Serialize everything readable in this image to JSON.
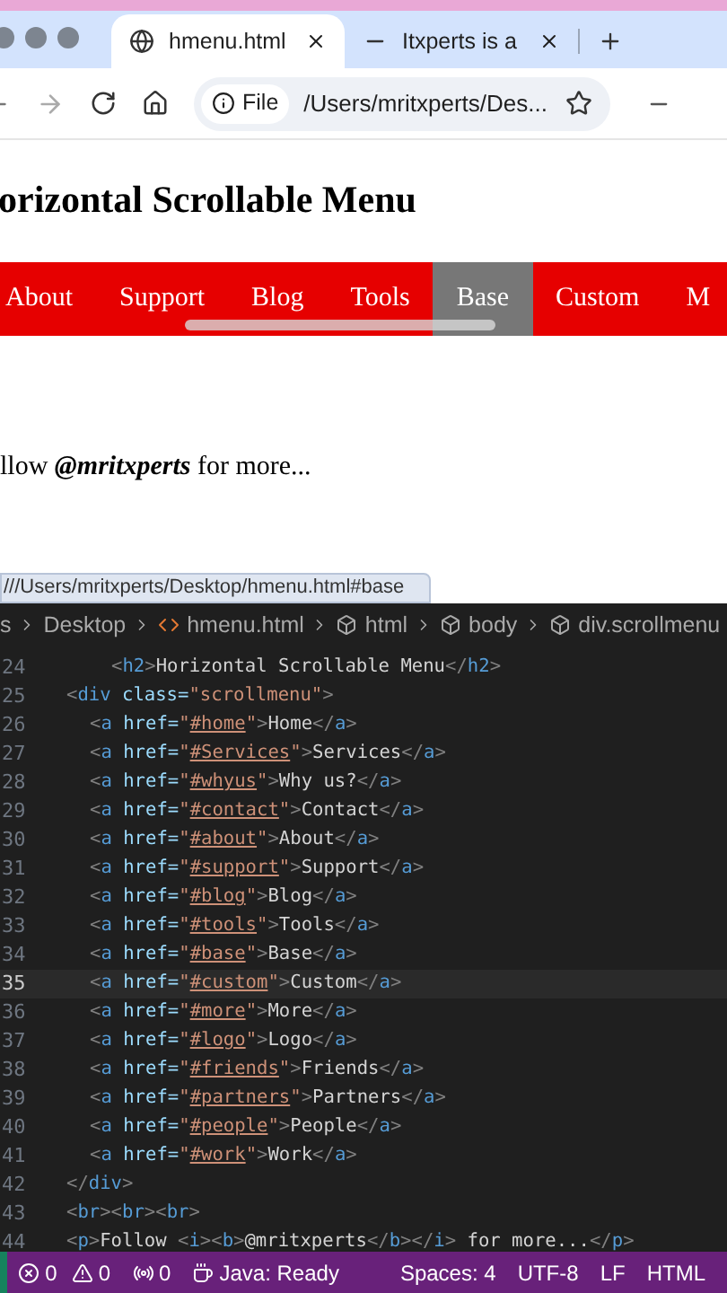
{
  "browser": {
    "tabs": [
      {
        "title": "hmenu.html",
        "selected": true
      },
      {
        "title": "Itxperts is a",
        "selected": false
      }
    ],
    "address": {
      "chip": "File",
      "url": "/Users/mritxperts/Des..."
    }
  },
  "page": {
    "heading": "orizontal Scrollable Menu",
    "menu": [
      {
        "label": "About",
        "selected": false
      },
      {
        "label": "Support",
        "selected": false
      },
      {
        "label": "Blog",
        "selected": false
      },
      {
        "label": "Tools",
        "selected": false
      },
      {
        "label": "Base",
        "selected": true
      },
      {
        "label": "Custom",
        "selected": false
      },
      {
        "label": "M",
        "selected": false
      }
    ],
    "follow": {
      "before": "llow ",
      "handle": "@mritxperts",
      "after": " for more..."
    },
    "link_preview": "///Users/mritxperts/Desktop/hmenu.html#base"
  },
  "editor": {
    "breadcrumbs": [
      {
        "label": "s",
        "kind": "folder"
      },
      {
        "label": "Desktop",
        "kind": "folder"
      },
      {
        "label": "hmenu.html",
        "kind": "file"
      },
      {
        "label": "html",
        "kind": "symbol"
      },
      {
        "label": "body",
        "kind": "symbol"
      },
      {
        "label": "div.scrollmenu",
        "kind": "symbol"
      }
    ],
    "lines": [
      {
        "number": "24",
        "current": false,
        "kind": "deep",
        "segments": [
          {
            "kind": "punct",
            "text": "<"
          },
          {
            "kind": "tag",
            "text": "h2"
          },
          {
            "kind": "punct",
            "text": ">"
          },
          {
            "kind": "text",
            "text": "Horizontal Scrollable Menu"
          },
          {
            "kind": "punct",
            "text": "</"
          },
          {
            "kind": "tag",
            "text": "h2"
          },
          {
            "kind": "punct",
            "text": ">"
          }
        ]
      },
      {
        "number": "25",
        "current": false,
        "segments": [
          {
            "kind": "punct",
            "text": "<"
          },
          {
            "kind": "tag",
            "text": "div"
          },
          {
            "kind": "attr",
            "text": " class="
          },
          {
            "kind": "str",
            "text": "\"scrollmenu\""
          },
          {
            "kind": "punct",
            "text": ">"
          }
        ]
      },
      {
        "number": "26",
        "current": false,
        "kind": "nested",
        "segments": [
          {
            "kind": "punct",
            "text": "<"
          },
          {
            "kind": "tag",
            "text": "a"
          },
          {
            "kind": "attr",
            "text": " href="
          },
          {
            "kind": "str",
            "text": "\""
          },
          {
            "kind": "link",
            "text": "#home"
          },
          {
            "kind": "str",
            "text": "\""
          },
          {
            "kind": "punct",
            "text": ">"
          },
          {
            "kind": "text",
            "text": "Home"
          },
          {
            "kind": "punct",
            "text": "</"
          },
          {
            "kind": "tag",
            "text": "a"
          },
          {
            "kind": "punct",
            "text": ">"
          }
        ]
      },
      {
        "number": "27",
        "current": false,
        "kind": "nested",
        "segments": [
          {
            "kind": "punct",
            "text": "<"
          },
          {
            "kind": "tag",
            "text": "a"
          },
          {
            "kind": "attr",
            "text": " href="
          },
          {
            "kind": "str",
            "text": "\""
          },
          {
            "kind": "link",
            "text": "#Services"
          },
          {
            "kind": "str",
            "text": "\""
          },
          {
            "kind": "punct",
            "text": ">"
          },
          {
            "kind": "text",
            "text": "Services"
          },
          {
            "kind": "punct",
            "text": "</"
          },
          {
            "kind": "tag",
            "text": "a"
          },
          {
            "kind": "punct",
            "text": ">"
          }
        ]
      },
      {
        "number": "28",
        "current": false,
        "kind": "nested",
        "segments": [
          {
            "kind": "punct",
            "text": "<"
          },
          {
            "kind": "tag",
            "text": "a"
          },
          {
            "kind": "attr",
            "text": " href="
          },
          {
            "kind": "str",
            "text": "\""
          },
          {
            "kind": "link",
            "text": "#whyus"
          },
          {
            "kind": "str",
            "text": "\""
          },
          {
            "kind": "punct",
            "text": ">"
          },
          {
            "kind": "text",
            "text": "Why us?"
          },
          {
            "kind": "punct",
            "text": "</"
          },
          {
            "kind": "tag",
            "text": "a"
          },
          {
            "kind": "punct",
            "text": ">"
          }
        ]
      },
      {
        "number": "29",
        "current": false,
        "kind": "nested",
        "segments": [
          {
            "kind": "punct",
            "text": "<"
          },
          {
            "kind": "tag",
            "text": "a"
          },
          {
            "kind": "attr",
            "text": " href="
          },
          {
            "kind": "str",
            "text": "\""
          },
          {
            "kind": "link",
            "text": "#contact"
          },
          {
            "kind": "str",
            "text": "\""
          },
          {
            "kind": "punct",
            "text": ">"
          },
          {
            "kind": "text",
            "text": "Contact"
          },
          {
            "kind": "punct",
            "text": "</"
          },
          {
            "kind": "tag",
            "text": "a"
          },
          {
            "kind": "punct",
            "text": ">"
          }
        ]
      },
      {
        "number": "30",
        "current": false,
        "kind": "nested",
        "segments": [
          {
            "kind": "punct",
            "text": "<"
          },
          {
            "kind": "tag",
            "text": "a"
          },
          {
            "kind": "attr",
            "text": " href="
          },
          {
            "kind": "str",
            "text": "\""
          },
          {
            "kind": "link",
            "text": "#about"
          },
          {
            "kind": "str",
            "text": "\""
          },
          {
            "kind": "punct",
            "text": ">"
          },
          {
            "kind": "text",
            "text": "About"
          },
          {
            "kind": "punct",
            "text": "</"
          },
          {
            "kind": "tag",
            "text": "a"
          },
          {
            "kind": "punct",
            "text": ">"
          }
        ]
      },
      {
        "number": "31",
        "current": false,
        "kind": "nested",
        "segments": [
          {
            "kind": "punct",
            "text": "<"
          },
          {
            "kind": "tag",
            "text": "a"
          },
          {
            "kind": "attr",
            "text": " href="
          },
          {
            "kind": "str",
            "text": "\""
          },
          {
            "kind": "link",
            "text": "#support"
          },
          {
            "kind": "str",
            "text": "\""
          },
          {
            "kind": "punct",
            "text": ">"
          },
          {
            "kind": "text",
            "text": "Support"
          },
          {
            "kind": "punct",
            "text": "</"
          },
          {
            "kind": "tag",
            "text": "a"
          },
          {
            "kind": "punct",
            "text": ">"
          }
        ]
      },
      {
        "number": "32",
        "current": false,
        "kind": "nested",
        "segments": [
          {
            "kind": "punct",
            "text": "<"
          },
          {
            "kind": "tag",
            "text": "a"
          },
          {
            "kind": "attr",
            "text": " href="
          },
          {
            "kind": "str",
            "text": "\""
          },
          {
            "kind": "link",
            "text": "#blog"
          },
          {
            "kind": "str",
            "text": "\""
          },
          {
            "kind": "punct",
            "text": ">"
          },
          {
            "kind": "text",
            "text": "Blog"
          },
          {
            "kind": "punct",
            "text": "</"
          },
          {
            "kind": "tag",
            "text": "a"
          },
          {
            "kind": "punct",
            "text": ">"
          }
        ]
      },
      {
        "number": "33",
        "current": false,
        "kind": "nested",
        "segments": [
          {
            "kind": "punct",
            "text": "<"
          },
          {
            "kind": "tag",
            "text": "a"
          },
          {
            "kind": "attr",
            "text": " href="
          },
          {
            "kind": "str",
            "text": "\""
          },
          {
            "kind": "link",
            "text": "#tools"
          },
          {
            "kind": "str",
            "text": "\""
          },
          {
            "kind": "punct",
            "text": ">"
          },
          {
            "kind": "text",
            "text": "Tools"
          },
          {
            "kind": "punct",
            "text": "</"
          },
          {
            "kind": "tag",
            "text": "a"
          },
          {
            "kind": "punct",
            "text": ">"
          }
        ]
      },
      {
        "number": "34",
        "current": false,
        "kind": "nested",
        "segments": [
          {
            "kind": "punct",
            "text": "<"
          },
          {
            "kind": "tag",
            "text": "a"
          },
          {
            "kind": "attr",
            "text": " href="
          },
          {
            "kind": "str",
            "text": "\""
          },
          {
            "kind": "link",
            "text": "#base"
          },
          {
            "kind": "str",
            "text": "\""
          },
          {
            "kind": "punct",
            "text": ">"
          },
          {
            "kind": "text",
            "text": "Base"
          },
          {
            "kind": "punct",
            "text": "</"
          },
          {
            "kind": "tag",
            "text": "a"
          },
          {
            "kind": "punct",
            "text": ">"
          }
        ]
      },
      {
        "number": "35",
        "current": true,
        "kind": "nested",
        "segments": [
          {
            "kind": "punct",
            "text": "<"
          },
          {
            "kind": "tag",
            "text": "a"
          },
          {
            "kind": "attr",
            "text": " href="
          },
          {
            "kind": "str",
            "text": "\""
          },
          {
            "kind": "link",
            "text": "#custom"
          },
          {
            "kind": "str",
            "text": "\""
          },
          {
            "kind": "punct",
            "text": ">"
          },
          {
            "kind": "text",
            "text": "Custom"
          },
          {
            "kind": "punct",
            "text": "</"
          },
          {
            "kind": "tag",
            "text": "a"
          },
          {
            "kind": "punct",
            "text": ">"
          }
        ]
      },
      {
        "number": "36",
        "current": false,
        "kind": "nested",
        "segments": [
          {
            "kind": "punct",
            "text": "<"
          },
          {
            "kind": "tag",
            "text": "a"
          },
          {
            "kind": "attr",
            "text": " href="
          },
          {
            "kind": "str",
            "text": "\""
          },
          {
            "kind": "link",
            "text": "#more"
          },
          {
            "kind": "str",
            "text": "\""
          },
          {
            "kind": "punct",
            "text": ">"
          },
          {
            "kind": "text",
            "text": "More"
          },
          {
            "kind": "punct",
            "text": "</"
          },
          {
            "kind": "tag",
            "text": "a"
          },
          {
            "kind": "punct",
            "text": ">"
          }
        ]
      },
      {
        "number": "37",
        "current": false,
        "kind": "nested",
        "segments": [
          {
            "kind": "punct",
            "text": "<"
          },
          {
            "kind": "tag",
            "text": "a"
          },
          {
            "kind": "attr",
            "text": " href="
          },
          {
            "kind": "str",
            "text": "\""
          },
          {
            "kind": "link",
            "text": "#logo"
          },
          {
            "kind": "str",
            "text": "\""
          },
          {
            "kind": "punct",
            "text": ">"
          },
          {
            "kind": "text",
            "text": "Logo"
          },
          {
            "kind": "punct",
            "text": "</"
          },
          {
            "kind": "tag",
            "text": "a"
          },
          {
            "kind": "punct",
            "text": ">"
          }
        ]
      },
      {
        "number": "38",
        "current": false,
        "kind": "nested",
        "segments": [
          {
            "kind": "punct",
            "text": "<"
          },
          {
            "kind": "tag",
            "text": "a"
          },
          {
            "kind": "attr",
            "text": " href="
          },
          {
            "kind": "str",
            "text": "\""
          },
          {
            "kind": "link",
            "text": "#friends"
          },
          {
            "kind": "str",
            "text": "\""
          },
          {
            "kind": "punct",
            "text": ">"
          },
          {
            "kind": "text",
            "text": "Friends"
          },
          {
            "kind": "punct",
            "text": "</"
          },
          {
            "kind": "tag",
            "text": "a"
          },
          {
            "kind": "punct",
            "text": ">"
          }
        ]
      },
      {
        "number": "39",
        "current": false,
        "kind": "nested",
        "segments": [
          {
            "kind": "punct",
            "text": "<"
          },
          {
            "kind": "tag",
            "text": "a"
          },
          {
            "kind": "attr",
            "text": " href="
          },
          {
            "kind": "str",
            "text": "\""
          },
          {
            "kind": "link",
            "text": "#partners"
          },
          {
            "kind": "str",
            "text": "\""
          },
          {
            "kind": "punct",
            "text": ">"
          },
          {
            "kind": "text",
            "text": "Partners"
          },
          {
            "kind": "punct",
            "text": "</"
          },
          {
            "kind": "tag",
            "text": "a"
          },
          {
            "kind": "punct",
            "text": ">"
          }
        ]
      },
      {
        "number": "40",
        "current": false,
        "kind": "nested",
        "segments": [
          {
            "kind": "punct",
            "text": "<"
          },
          {
            "kind": "tag",
            "text": "a"
          },
          {
            "kind": "attr",
            "text": " href="
          },
          {
            "kind": "str",
            "text": "\""
          },
          {
            "kind": "link",
            "text": "#people"
          },
          {
            "kind": "str",
            "text": "\""
          },
          {
            "kind": "punct",
            "text": ">"
          },
          {
            "kind": "text",
            "text": "People"
          },
          {
            "kind": "punct",
            "text": "</"
          },
          {
            "kind": "tag",
            "text": "a"
          },
          {
            "kind": "punct",
            "text": ">"
          }
        ]
      },
      {
        "number": "41",
        "current": false,
        "kind": "nested",
        "segments": [
          {
            "kind": "punct",
            "text": "<"
          },
          {
            "kind": "tag",
            "text": "a"
          },
          {
            "kind": "attr",
            "text": " href="
          },
          {
            "kind": "str",
            "text": "\""
          },
          {
            "kind": "link",
            "text": "#work"
          },
          {
            "kind": "str",
            "text": "\""
          },
          {
            "kind": "punct",
            "text": ">"
          },
          {
            "kind": "text",
            "text": "Work"
          },
          {
            "kind": "punct",
            "text": "</"
          },
          {
            "kind": "tag",
            "text": "a"
          },
          {
            "kind": "punct",
            "text": ">"
          }
        ]
      },
      {
        "number": "42",
        "current": false,
        "segments": [
          {
            "kind": "punct",
            "text": "</"
          },
          {
            "kind": "tag",
            "text": "div"
          },
          {
            "kind": "punct",
            "text": ">"
          }
        ]
      },
      {
        "number": "43",
        "current": false,
        "segments": [
          {
            "kind": "punct",
            "text": "<"
          },
          {
            "kind": "tag",
            "text": "br"
          },
          {
            "kind": "punct",
            "text": "><"
          },
          {
            "kind": "tag",
            "text": "br"
          },
          {
            "kind": "punct",
            "text": "><"
          },
          {
            "kind": "tag",
            "text": "br"
          },
          {
            "kind": "punct",
            "text": ">"
          }
        ]
      },
      {
        "number": "44",
        "current": false,
        "segments": [
          {
            "kind": "punct",
            "text": "<"
          },
          {
            "kind": "tag",
            "text": "p"
          },
          {
            "kind": "punct",
            "text": ">"
          },
          {
            "kind": "text",
            "text": "Follow "
          },
          {
            "kind": "punct",
            "text": "<"
          },
          {
            "kind": "tag",
            "text": "i"
          },
          {
            "kind": "punct",
            "text": "><"
          },
          {
            "kind": "tag",
            "text": "b"
          },
          {
            "kind": "punct",
            "text": ">"
          },
          {
            "kind": "text",
            "text": "@mritxperts"
          },
          {
            "kind": "punct",
            "text": "</"
          },
          {
            "kind": "tag",
            "text": "b"
          },
          {
            "kind": "punct",
            "text": "></"
          },
          {
            "kind": "tag",
            "text": "i"
          },
          {
            "kind": "punct",
            "text": ">"
          },
          {
            "kind": "text",
            "text": " for more..."
          },
          {
            "kind": "punct",
            "text": "</"
          },
          {
            "kind": "tag",
            "text": "p"
          },
          {
            "kind": "punct",
            "text": ">"
          }
        ]
      }
    ]
  },
  "status_bar": [
    {
      "kind": "errors",
      "text": "0"
    },
    {
      "kind": "warnings",
      "text": "0"
    },
    {
      "kind": "ports",
      "text": "0"
    },
    {
      "kind": "java",
      "text": "Java: Ready"
    },
    {
      "kind": "plain",
      "text": "Spaces: 4"
    },
    {
      "kind": "plain",
      "text": "UTF-8"
    },
    {
      "kind": "plain",
      "text": "LF"
    },
    {
      "kind": "plain",
      "text": "HTML"
    }
  ]
}
